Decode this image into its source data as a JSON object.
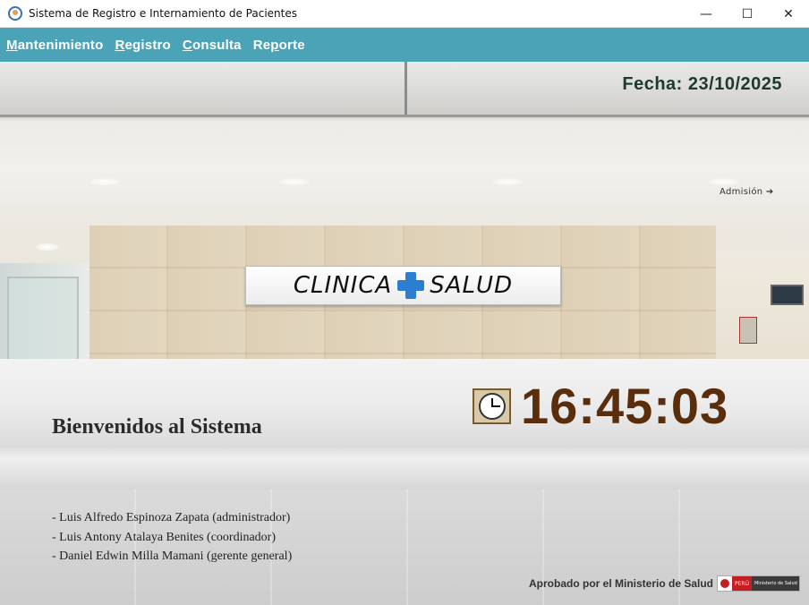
{
  "window": {
    "title": "Sistema de Registro e Internamiento de Pacientes",
    "controls": {
      "minimize": "—",
      "maximize": "☐",
      "close": "✕"
    }
  },
  "menu": {
    "items": [
      {
        "mnemonic": "M",
        "rest": "antenimiento"
      },
      {
        "mnemonic": "R",
        "rest": "egistro"
      },
      {
        "mnemonic": "C",
        "rest": "onsulta"
      },
      {
        "pre": "Re",
        "mnemonic": "p",
        "rest": "orte"
      }
    ]
  },
  "header": {
    "fecha": "Fecha: 23/10/2025"
  },
  "logo": {
    "left_word": "CLINICA",
    "right_word": "SALUD"
  },
  "scene_sign": "Admisión ➔",
  "clock": {
    "time": "16:45:03"
  },
  "welcome": "Bienvenidos al Sistema",
  "credits": [
    "- Luis Alfredo Espinoza Zapata (administrador)",
    "- Luis Antony Atalaya Benites (coordinador)",
    "- Daniel Edwin Milla Mamani (gerente general)"
  ],
  "footer": {
    "approved": "Aprobado por el Ministerio de Salud",
    "badge_country": "PERÚ",
    "badge_ministry": "Ministerio de Salud"
  },
  "colors": {
    "menu_bar": "#4ba3b8",
    "time_color": "#5a2d0c",
    "date_color": "#1f3a2c",
    "logo_cross": "#2c7fd0"
  }
}
